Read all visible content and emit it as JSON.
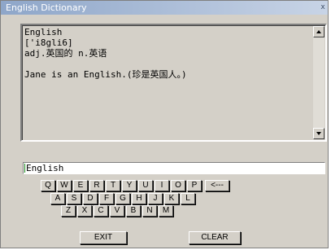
{
  "window": {
    "title": "English Dictionary",
    "close_label": "x"
  },
  "output": {
    "lines": [
      "English",
      "['i8gli6]",
      "adj.英国的 n.英语",
      "",
      "Jane is an English.(珍是英国人。)"
    ]
  },
  "input": {
    "value": "English",
    "placeholder": ""
  },
  "keyboard": {
    "row1": [
      "Q",
      "W",
      "E",
      "R",
      "T",
      "Y",
      "U",
      "I",
      "O",
      "P",
      "<---"
    ],
    "row2": [
      "A",
      "S",
      "D",
      "F",
      "G",
      "H",
      "J",
      "K",
      "L"
    ],
    "row3": [
      "Z",
      "X",
      "C",
      "V",
      "B",
      "N",
      "M"
    ]
  },
  "buttons": {
    "exit": "EXIT",
    "clear": "CLEAR"
  },
  "colors": {
    "face": "#d4d0c8",
    "title_gradient_start": "#8ea6c9",
    "title_gradient_end": "#c8d4e6",
    "caret": "#1a8f1a"
  }
}
